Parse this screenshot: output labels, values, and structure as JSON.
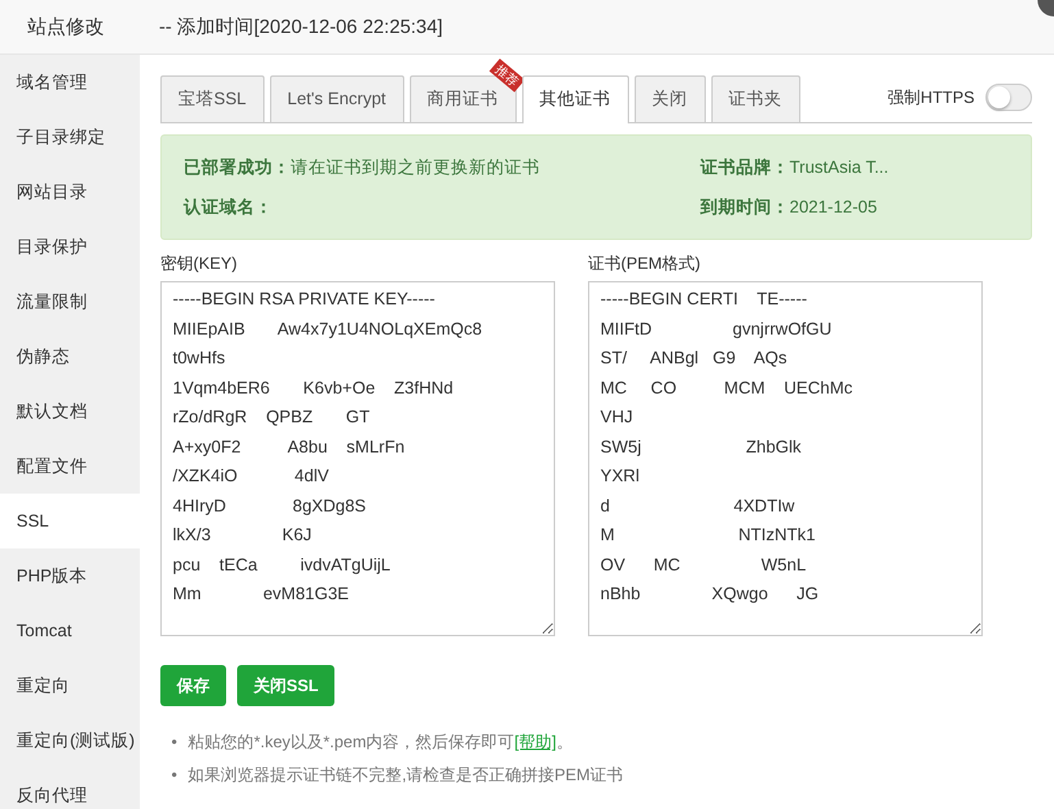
{
  "window": {
    "title": "站点修改",
    "subtitle": "-- 添加时间[2020-12-06 22:25:34]"
  },
  "sidebar": {
    "items": [
      {
        "label": "域名管理",
        "selected": false
      },
      {
        "label": "子目录绑定",
        "selected": false
      },
      {
        "label": "网站目录",
        "selected": false
      },
      {
        "label": "目录保护",
        "selected": false
      },
      {
        "label": "流量限制",
        "selected": false
      },
      {
        "label": "伪静态",
        "selected": false
      },
      {
        "label": "默认文档",
        "selected": false
      },
      {
        "label": "配置文件",
        "selected": false
      },
      {
        "label": "SSL",
        "selected": true
      },
      {
        "label": "PHP版本",
        "selected": false
      },
      {
        "label": "Tomcat",
        "selected": false
      },
      {
        "label": "重定向",
        "selected": false
      },
      {
        "label": "重定向(测试版)",
        "selected": false
      },
      {
        "label": "反向代理",
        "selected": false
      }
    ]
  },
  "tabs": [
    {
      "label": "宝塔SSL",
      "selected": false
    },
    {
      "label": "Let's Encrypt",
      "selected": false
    },
    {
      "label": "商用证书",
      "selected": false,
      "badge": "推荐"
    },
    {
      "label": "其他证书",
      "selected": true
    },
    {
      "label": "关闭",
      "selected": false
    },
    {
      "label": "证书夹",
      "selected": false
    }
  ],
  "force_https": {
    "label": "强制HTTPS",
    "on": false
  },
  "status": {
    "deployed_label": "已部署成功：",
    "deployed_text": "请在证书到期之前更换新的证书",
    "domain_label": "认证域名：",
    "brand_label": "证书品牌：",
    "brand_value": "TrustAsia T...",
    "expiry_label": "到期时间：",
    "expiry_value": "2021-12-05"
  },
  "key": {
    "label": "密钥(KEY)",
    "lines": [
      "-----BEGIN RSA PRIVATE KEY-----",
      "MIIEpAIB       Aw4x7y1U4NOLqXEmQc8",
      "t0wHfs",
      "1Vqm4bER6       K6vb+Oe    Z3fHNd",
      "rZo/dRgR    QPBZ       GT",
      "A+xy0F2          A8bu    sMLrFn",
      "/XZK4iO            4dlV",
      "4HIryD              8gXDg8S",
      "lkX/3               K6J",
      "pcu    tECa         ivdvATgUijL",
      "Mm             evM81G3E"
    ]
  },
  "cert": {
    "label": "证书(PEM格式)",
    "lines": [
      "-----BEGIN CERTI    TE-----",
      "MIIFtD                 gvnjrrwOfGU",
      "ST/     ANBgl   G9    AQs",
      "MC     CO          MCM    UEChMc",
      "VHJ",
      "SW5j                      ZhbGlk",
      "YXRl",
      "d                          4XDTIw",
      "M                          NTIzNTk1",
      "OV      MC                 W5nL",
      "nBhb               XQwgo      JG"
    ]
  },
  "buttons": [
    "保存",
    "关闭SSL"
  ],
  "notes": [
    {
      "bullet": "•",
      "text": "粘贴您的*.key以及*.pem内容，然后保存即可",
      "link": "[帮助]",
      "suffix": "。"
    },
    {
      "bullet": "•",
      "text": "如果浏览器提示证书链不完整,请检查是否正确拼接PEM证书"
    }
  ]
}
